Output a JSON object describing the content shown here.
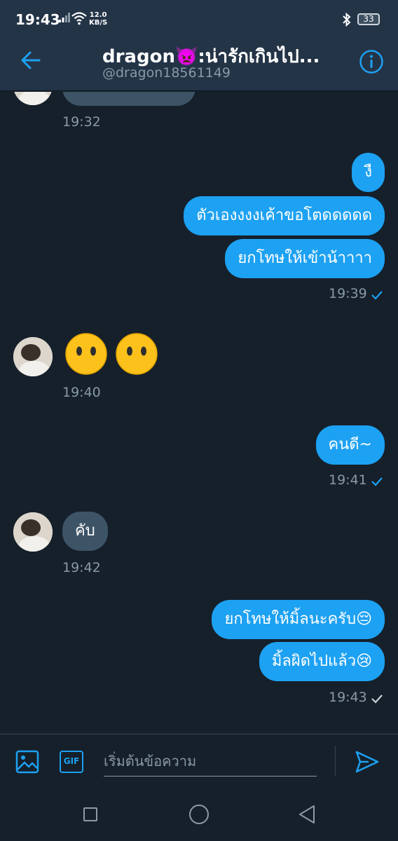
{
  "status_bar": {
    "time": "19:43",
    "speed_value": "12.0",
    "speed_unit": "KB/S",
    "battery": "33"
  },
  "header": {
    "title": "dragon👿:น่ารักเกินไป...",
    "handle": "@dragon18561149"
  },
  "messages": [
    {
      "direction": "in",
      "text": "",
      "time": "19:32",
      "partial": true
    },
    {
      "direction": "out",
      "text": "งื",
      "time": ""
    },
    {
      "direction": "out",
      "text": "ตัวเองงงงเค้าขอโตดดดดด",
      "time": ""
    },
    {
      "direction": "out",
      "text": "ยกโทษให้เข้าน้าาาา",
      "time": "19:39",
      "status": "read"
    },
    {
      "direction": "in",
      "text": "😶😶",
      "time": "19:40"
    },
    {
      "direction": "out",
      "text": "คนดี~",
      "time": "19:41",
      "status": "read"
    },
    {
      "direction": "in",
      "text": "คับ",
      "time": "19:42"
    },
    {
      "direction": "out",
      "text": "ยกโทษให้มิ้ลนะครับ😔",
      "time": ""
    },
    {
      "direction": "out",
      "text": "มิ้ลผิดไปแล้ว😢",
      "time": "19:43",
      "status": "sent"
    }
  ],
  "composer": {
    "placeholder": "เริ่มต้นข้อความ",
    "gif_label": "GIF"
  },
  "colors": {
    "background": "#15202b",
    "header": "#243447",
    "accent": "#1da1f2",
    "incoming_bubble": "#3d5466",
    "muted": "#8899a6"
  }
}
